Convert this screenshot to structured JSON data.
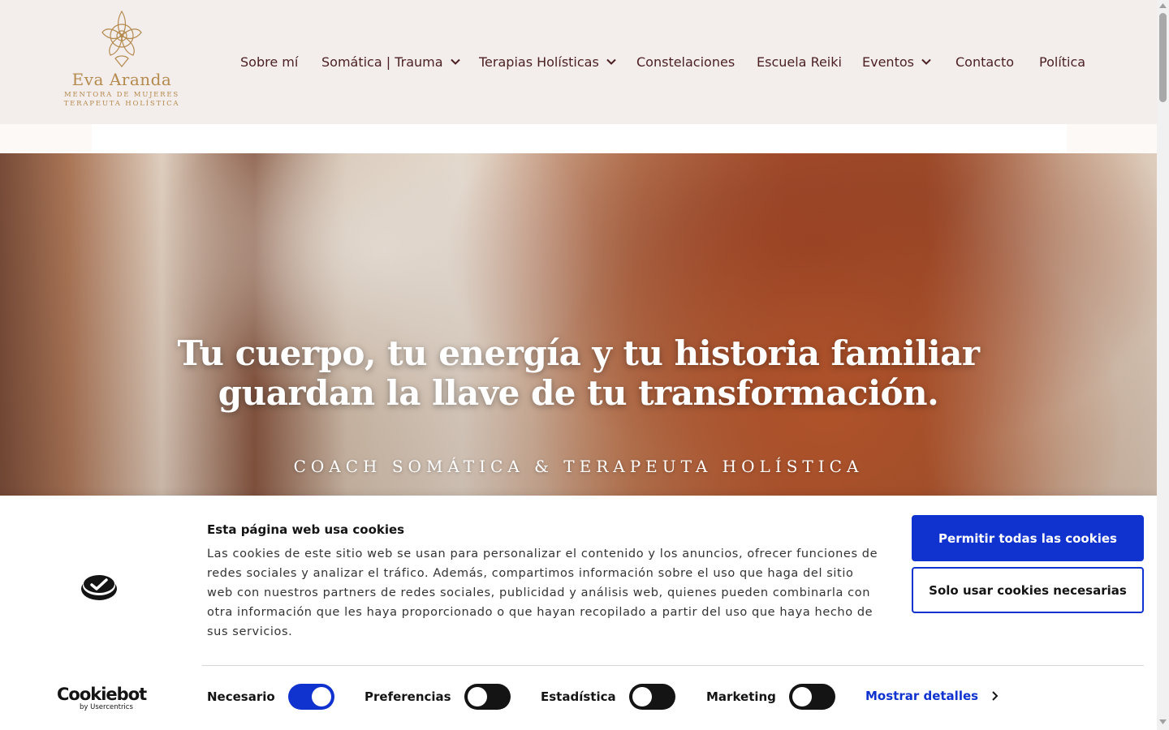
{
  "brand": {
    "name": "Eva Aranda",
    "tagline_1": "MENTORA DE MUJERES",
    "tagline_2": "TERAPEUTA HOLÍSTICA",
    "color": "#b48a4e"
  },
  "nav": {
    "items": [
      {
        "label": "Sobre mí",
        "has_dropdown": false
      },
      {
        "label": "Somática | Trauma",
        "has_dropdown": true
      },
      {
        "label": "Terapias Holísticas",
        "has_dropdown": true
      },
      {
        "label": "Constelaciones",
        "has_dropdown": false
      },
      {
        "label": "Escuela Reiki",
        "has_dropdown": false
      },
      {
        "label": "Eventos",
        "has_dropdown": true
      },
      {
        "label": "Contacto",
        "has_dropdown": false
      },
      {
        "label": "Política",
        "has_dropdown": false
      }
    ],
    "text_color": "#4a1f22"
  },
  "hero": {
    "title_line_1": "Tu cuerpo, tu energía y tu historia familiar",
    "title_line_2": "guardan la llave de tu transformación.",
    "subtitle": "COACH SOMÁTICA & TERAPEUTA HOLÍSTICA"
  },
  "cookie_banner": {
    "title": "Esta página web usa cookies",
    "text": "Las cookies de este sitio web se usan para personalizar el contenido y los anuncios, ofrecer funciones de redes sociales y analizar el tráfico. Además, compartimos información sobre el uso que haga del sitio web con nuestros partners de redes sociales, publicidad y análisis web, quienes pueden combinarla con otra información que les haya proporcionado o que hayan recopilado a partir del uso que haya hecho de sus servicios.",
    "allow_all_label": "Permitir todas las cookies",
    "necessary_only_label": "Solo usar cookies necesarias",
    "toggles": [
      {
        "label": "Necesario",
        "on": true
      },
      {
        "label": "Preferencias",
        "on": false
      },
      {
        "label": "Estadística",
        "on": false
      },
      {
        "label": "Marketing",
        "on": false
      }
    ],
    "details_label": "Mostrar detalles",
    "provider": "Cookiebot",
    "provider_by": "by Usercentrics",
    "accent_color": "#1032cf"
  }
}
